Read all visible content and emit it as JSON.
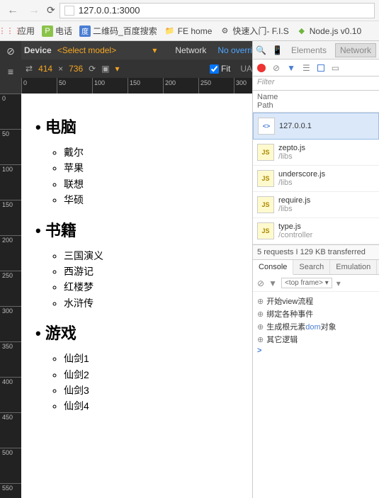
{
  "browser": {
    "url": "127.0.0.1:3000"
  },
  "bookmarks": {
    "apps": "应用",
    "phone": "电话",
    "qr": "二维码_百度搜索",
    "fe": "FE home",
    "fis": "快速入门- F.I.S",
    "node": "Node.js v0.10"
  },
  "device_panel": {
    "device_label": "Device",
    "select_model": "<Select model>",
    "network_tab": "Network",
    "no_override": "No overri",
    "width": "414",
    "times": "×",
    "height": "736",
    "fit": "Fit",
    "ua": "UA"
  },
  "ruler_h": [
    "0",
    "50",
    "100",
    "150",
    "200",
    "250",
    "300"
  ],
  "ruler_v": [
    "0",
    "50",
    "100",
    "150",
    "200",
    "250",
    "300",
    "350",
    "400",
    "450",
    "500",
    "550"
  ],
  "page": {
    "sections": [
      {
        "title": "电脑",
        "items": [
          "戴尔",
          "苹果",
          "联想",
          "华硕"
        ]
      },
      {
        "title": "书籍",
        "items": [
          "三国演义",
          "西游记",
          "红楼梦",
          "水浒传"
        ]
      },
      {
        "title": "游戏",
        "items": [
          "仙剑1",
          "仙剑2",
          "仙剑3",
          "仙剑4"
        ]
      }
    ]
  },
  "devtools": {
    "tabs": {
      "elements": "Elements",
      "network": "Network"
    },
    "filter_placeholder": "Filter",
    "name_header": "Name",
    "path_header": "Path",
    "requests": [
      {
        "name": "127.0.0.1",
        "path": "",
        "type": "html"
      },
      {
        "name": "zepto.js",
        "path": "/libs",
        "type": "js"
      },
      {
        "name": "underscore.js",
        "path": "/libs",
        "type": "js"
      },
      {
        "name": "require.js",
        "path": "/libs",
        "type": "js"
      },
      {
        "name": "type.js",
        "path": "/controller",
        "type": "js"
      }
    ],
    "summary": "5 requests I 129 KB transferred",
    "console_tabs": {
      "console": "Console",
      "search": "Search",
      "emulation": "Emulation"
    },
    "top_frame": "<top frame>",
    "logs": [
      "开始view流程",
      "绑定各种事件",
      "生成根元素dom对象",
      "其它逻辑"
    ]
  }
}
